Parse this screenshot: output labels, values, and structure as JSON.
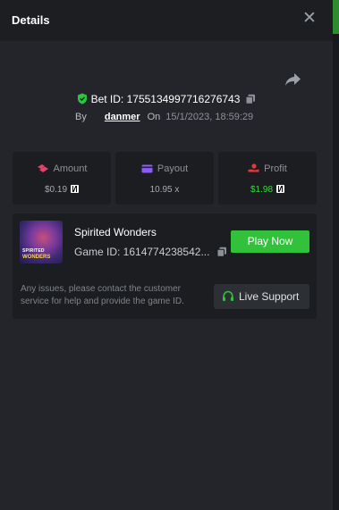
{
  "header": {
    "title": "Details",
    "close_glyph": "✕"
  },
  "colors": {
    "accent_green": "#31c13a",
    "profit_green": "#3fd440",
    "shield_green": "#27c93f",
    "amount_pink": "#e8416a",
    "payout_purple": "#8b5cf6",
    "profit_red": "#e03a3a"
  },
  "bet": {
    "id_label": "Bet ID: 1755134997716276743",
    "by_label": "By",
    "user": "danmer",
    "on_label": "On",
    "datetime": "15/1/2023, 18:59:29"
  },
  "stats": [
    {
      "label": "Amount",
      "value": "$0.19",
      "icon": "coins-icon"
    },
    {
      "label": "Payout",
      "value": "10.95 x",
      "icon": "card-icon"
    },
    {
      "label": "Profit",
      "value": "$1.98",
      "icon": "hand-coin-icon"
    }
  ],
  "game": {
    "name": "Spirited Wonders",
    "thumb_line1": "SPIRITED",
    "thumb_line2": "WONDERS",
    "id_label": "Game ID: 1614774238542...",
    "play_label": "Play Now",
    "help_text": "Any issues, please contact the customer service for help and provide the game ID.",
    "support_label": "Live Support"
  }
}
